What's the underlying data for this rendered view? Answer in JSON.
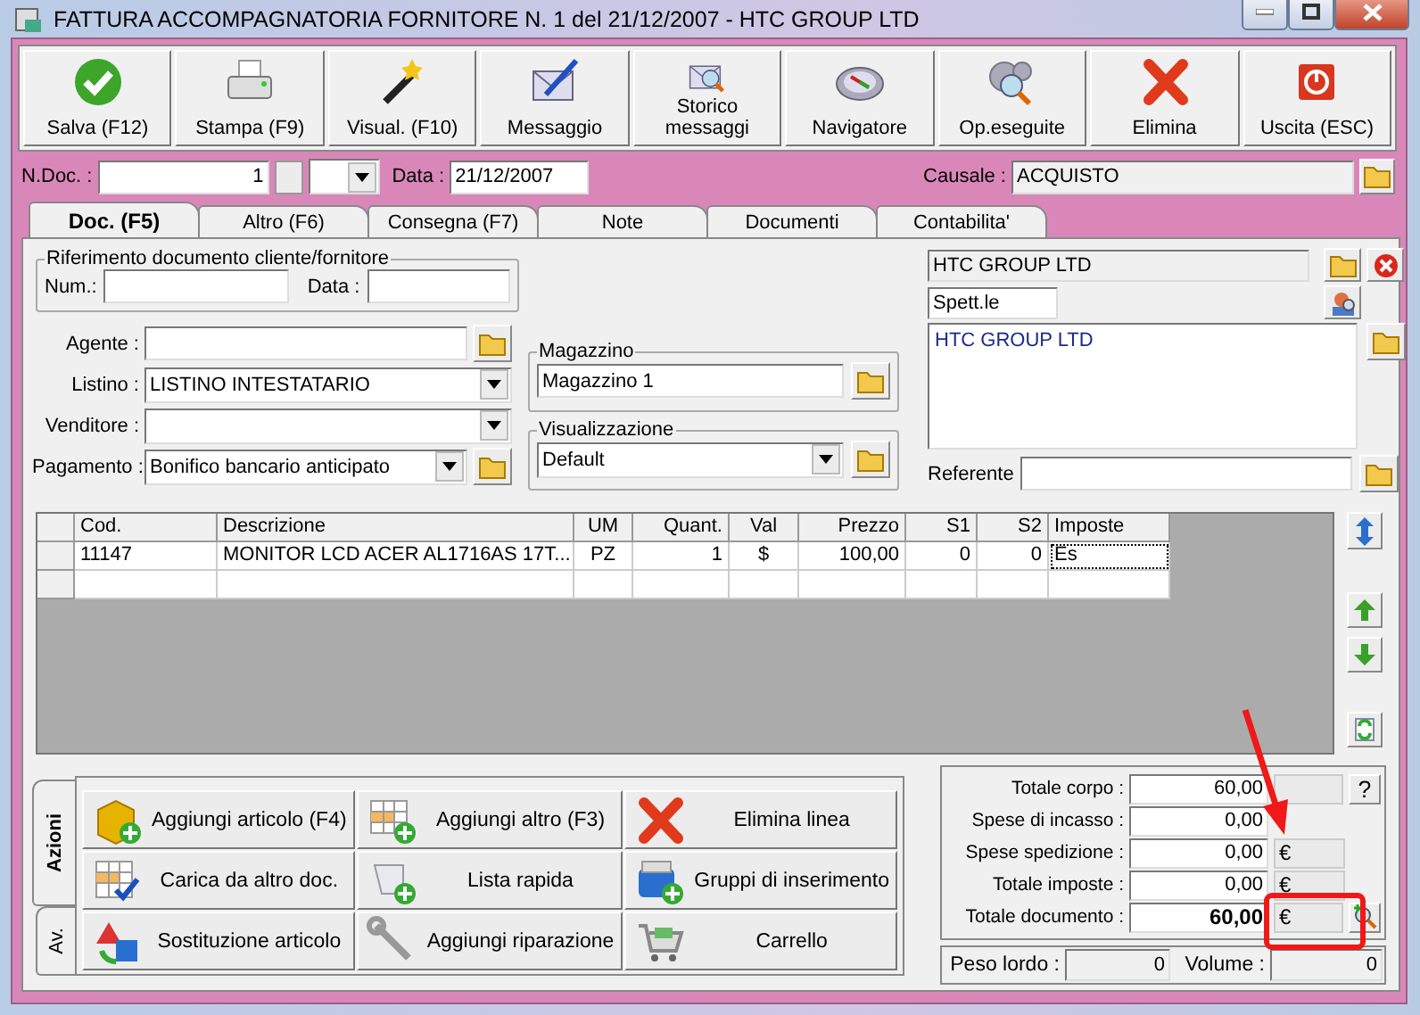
{
  "window": {
    "title": "FATTURA ACCOMPAGNATORIA FORNITORE N. 1  del 21/12/2007 - HTC GROUP LTD"
  },
  "toolbar": [
    {
      "label": "Salva (F12)"
    },
    {
      "label": "Stampa (F9)"
    },
    {
      "label": "Visual. (F10)"
    },
    {
      "label": "Messaggio"
    },
    {
      "label": "Storico messaggi"
    },
    {
      "label": "Navigatore"
    },
    {
      "label": "Op.eseguite"
    },
    {
      "label": "Elimina"
    },
    {
      "label": "Uscita (ESC)"
    }
  ],
  "header": {
    "doc_label": "N.Doc. :",
    "doc_number": "1",
    "date_label": "Data :",
    "date": "21/12/2007",
    "causale_label": "Causale :",
    "causale": "ACQUISTO"
  },
  "tabs": [
    {
      "label": "Doc. (F5)",
      "selected": true
    },
    {
      "label": "Altro (F6)",
      "selected": false
    },
    {
      "label": "Consegna (F7)",
      "selected": false
    },
    {
      "label": "Note",
      "selected": false
    },
    {
      "label": "Documenti",
      "selected": false
    },
    {
      "label": "Contabilita'",
      "selected": false
    }
  ],
  "reference": {
    "title": "Riferimento documento cliente/fornitore",
    "num_label": "Num.:",
    "date_label": "Data :"
  },
  "fields": [
    {
      "kind": "text",
      "label": "Agente :",
      "folder": true
    },
    {
      "kind": "select",
      "label": "Listino :",
      "value": "LISTINO INTESTATARIO",
      "folder": false
    },
    {
      "kind": "select",
      "label": "Venditore :",
      "folder": false
    },
    {
      "kind": "select",
      "label": "Pagamento :",
      "value": "Bonifico bancario anticipato",
      "folder": true
    }
  ],
  "groups": [
    {
      "kind": "text",
      "title": "Magazzino",
      "value": "Magazzino 1"
    },
    {
      "kind": "select",
      "title": "Visualizzazione",
      "value": "Default"
    }
  ],
  "party": {
    "name": "HTC GROUP LTD",
    "salutation": "Spett.le",
    "address": "HTC GROUP LTD",
    "referente_label": "Referente"
  },
  "table": {
    "columns": [
      "Cod.",
      "Descrizione",
      "UM",
      "Quant.",
      "Val",
      "Prezzo",
      "S1",
      "S2",
      "Imposte"
    ],
    "rows": [
      [
        "11147",
        "MONITOR LCD ACER AL1716AS 17T...",
        "PZ",
        "1",
        "$",
        "100,00",
        "0",
        "0",
        "Es"
      ],
      [
        "",
        "",
        "",
        "",
        "",
        "",
        "",
        "",
        ""
      ]
    ]
  },
  "action_tabs": [
    {
      "label": "Azioni",
      "selected": true
    },
    {
      "label": "Av.",
      "selected": false
    }
  ],
  "actions": [
    {
      "label": "Aggiungi articolo (F4)"
    },
    {
      "label": "Aggiungi altro (F3)"
    },
    {
      "label": "Elimina linea"
    },
    {
      "label": "Carica da altro doc."
    },
    {
      "label": "Lista rapida"
    },
    {
      "label": "Gruppi di inserimento"
    },
    {
      "label": "Sostituzione articolo"
    },
    {
      "label": "Aggiungi riparazione"
    },
    {
      "label": "Carrello"
    }
  ],
  "totals": [
    {
      "kind": "help",
      "label": "Totale corpo :",
      "value": "60,00",
      "bold": false,
      "button": "?"
    },
    {
      "kind": "plain",
      "label": "Spese di incasso :",
      "value": "0,00",
      "bold": false
    },
    {
      "kind": "currency",
      "label": "Spese spedizione :",
      "value": "0,00",
      "bold": false,
      "currency": "€"
    },
    {
      "kind": "currency",
      "label": "Totale imposte :",
      "value": "0,00",
      "bold": false,
      "currency": "€"
    },
    {
      "kind": "detail",
      "label": "Totale documento :",
      "value": "60,00",
      "bold": true,
      "currency": "€"
    }
  ],
  "weights": {
    "weight_label": "Peso lordo :",
    "weight": "0",
    "volume_label": "Volume :",
    "volume": "0"
  },
  "annotations": {
    "arrow": true,
    "highlight_box": true
  }
}
